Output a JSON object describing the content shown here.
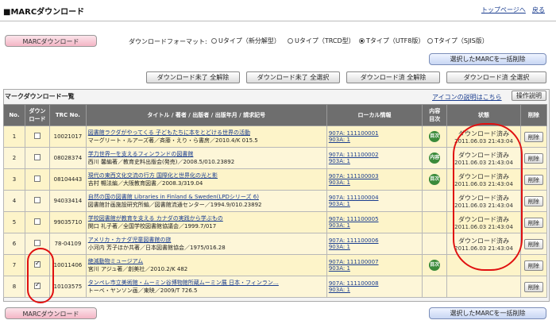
{
  "header": {
    "title": "■MARCダウンロード",
    "top_link": "トップページへ",
    "back_link": "戻る"
  },
  "controls": {
    "marc_download_label": "MARCダウンロード",
    "format_label": "ダウンロードフォーマット:",
    "format_options": [
      {
        "label": "Uタイプ（新分解型）",
        "selected": false
      },
      {
        "label": "Uタイプ（TRCD型）",
        "selected": false
      },
      {
        "label": "Tタイプ（UTF8版）",
        "selected": true
      },
      {
        "label": "Tタイプ（SJIS版）",
        "selected": false
      }
    ],
    "bulk_delete_label": "選択したMARCを一括削除",
    "buttons": [
      "ダウンロード未了 全解除",
      "ダウンロード未了 全選択",
      "ダウンロード済 全解除",
      "ダウンロード済 全選択"
    ]
  },
  "panel": {
    "heading": "マークダウンロード一覧",
    "icon_help_link": "アイコンの説明はこちら",
    "help_button": "操作説明"
  },
  "table": {
    "headers": [
      "No.",
      "ダウン\nロード",
      "TRC No.",
      "タイトル / 著者 / 出版者 / 出版年月 / 請求記号",
      "ローカル情報",
      "内容\n目次",
      "状態",
      "削除"
    ],
    "rows": [
      {
        "no": "1",
        "checked": false,
        "trc": "10021017",
        "title": "図書館ラクダがやってくる 子どもたちに本をとどける世界の活動",
        "sub": "マーグリート・ルアーズ著／斉藤・えり・ら書房／2010.4/K 015.5",
        "local1": "907A: 111100001",
        "local2": "903A: 1",
        "badge": "目次",
        "status": "ダウンロード済み",
        "date": "2011.06.03 21:43:04",
        "delete": "削除"
      },
      {
        "no": "2",
        "checked": false,
        "trc": "08028374",
        "title": "学力世界一を支えるフィンランドの図書館",
        "sub": "西川 馨編著／教育史料出版会(発売)／2008.5/010.23892",
        "local1": "907A: 111100002",
        "local2": "903A: 1",
        "badge": "内容",
        "status": "ダウンロード済み",
        "date": "2011.06.03 21:43:04",
        "delete": "削除"
      },
      {
        "no": "3",
        "checked": false,
        "trc": "08104443",
        "title": "現代の東西文化交流の行方 国際化と世界化の光と影",
        "sub": "吉村 暢法編／大阪教育図書／2008.3/319.04",
        "local1": "907A: 111100003",
        "local2": "903A: 1",
        "badge": "目次",
        "status": "ダウンロード済み",
        "date": "2011.06.03 21:43:04",
        "delete": "削除"
      },
      {
        "no": "4",
        "checked": false,
        "trc": "94033414",
        "title": "自然の国の図書館 Libraries in Finland & Sweden(LPDシリーズ 6)",
        "sub": "図書館計画施設研究所編／図書館流通センター／1994.9/010.23892",
        "local1": "907A: 111100004",
        "local2": "903A: 1",
        "badge": "",
        "status": "ダウンロード済み",
        "date": "2011.06.03 21:43:04",
        "delete": "削除"
      },
      {
        "no": "5",
        "checked": false,
        "trc": "99035710",
        "title": "学校図書館が教育を支える カナダの実践から学ぶもの",
        "sub": "関口 礼子著／全国学校図書館協議会／1999.7/017",
        "local1": "907A: 111100005",
        "local2": "903A: 1",
        "badge": "",
        "status": "ダウンロード済み",
        "date": "2011.06.03 21:43:04",
        "delete": "削除"
      },
      {
        "no": "6",
        "checked": false,
        "trc": "78-04109",
        "title": "アメリカ・カナダ児童図書館の旅",
        "sub": "小河内 芳子ほか共著／日本図書館協会／1975/016.28",
        "local1": "907A: 111100006",
        "local2": "903A: 1",
        "badge": "",
        "status": "ダウンロード済み",
        "date": "2011.06.03 21:43:04",
        "delete": "削除"
      },
      {
        "no": "7",
        "checked": true,
        "trc": "10011406",
        "title": "絶滅動物ミュージアム",
        "sub": "宮川 アジュ著／創美社／2010.2/K 482",
        "local1": "907A: 111100007",
        "local2": "903A: 1",
        "badge": "目次",
        "status": "",
        "date": "",
        "delete": "削除"
      },
      {
        "no": "8",
        "checked": true,
        "trc": "10103575",
        "title": "タンペレ市立美術館・ムーミン谷博物館所蔵ムーミン展 日本・フィンラン…",
        "sub": "トーベ・ヤンソン画／東映／2009/T 726.5",
        "local1": "907A: 111100008",
        "local2": "903A: 1",
        "badge": "",
        "status": "",
        "date": "",
        "delete": "削除"
      }
    ]
  },
  "colors": {
    "header_bg": "#6e6e6e",
    "row_bg": "#fdf4c9",
    "highlight": "#e01010",
    "badge": "#3a8a3a"
  }
}
